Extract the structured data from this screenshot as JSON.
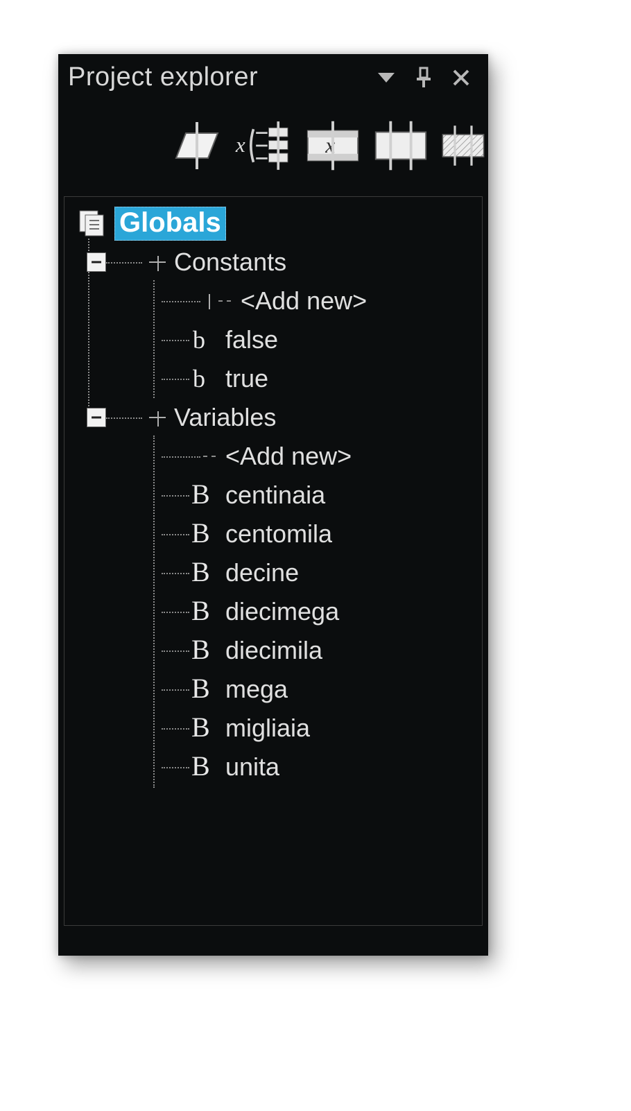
{
  "panel": {
    "title": "Project explorer"
  },
  "tree": {
    "root": "Globals",
    "constants_label": "Constants",
    "variables_label": "Variables",
    "add_new_label": "<Add new>",
    "constants": [
      {
        "name": "false"
      },
      {
        "name": "true"
      }
    ],
    "variables": [
      {
        "name": "centinaia"
      },
      {
        "name": "centomila"
      },
      {
        "name": "decine"
      },
      {
        "name": "diecimega"
      },
      {
        "name": "diecimila"
      },
      {
        "name": "mega"
      },
      {
        "name": "migliaia"
      },
      {
        "name": "unita"
      }
    ]
  }
}
